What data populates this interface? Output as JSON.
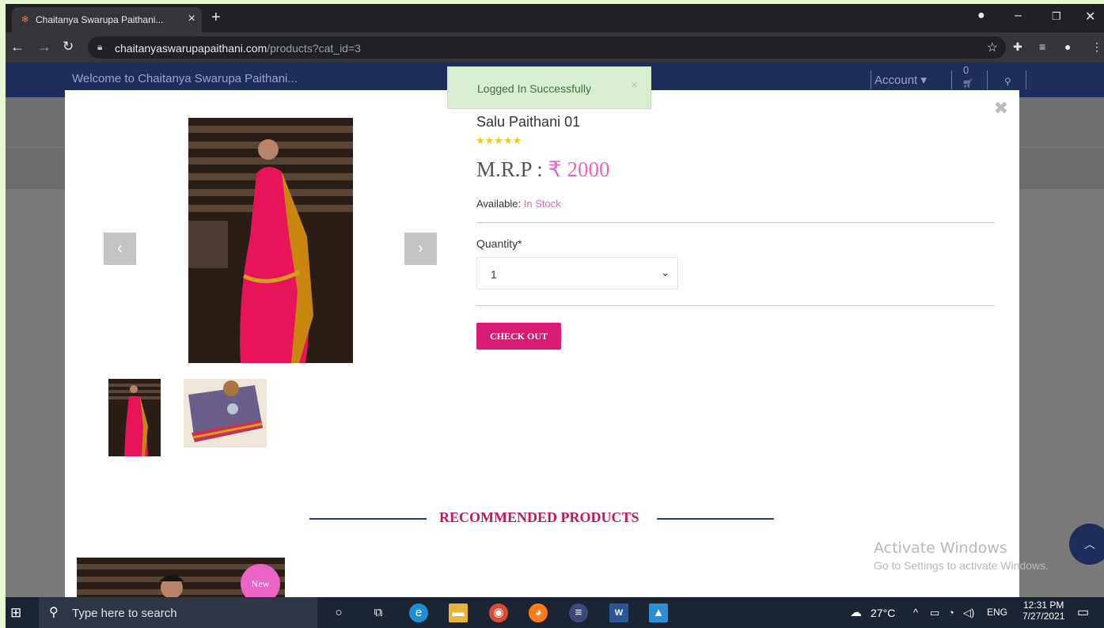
{
  "browser": {
    "tab_title": "Chaitanya Swarupa Paithani...",
    "url_host": "chaitanyaswarupapaithani.com",
    "url_path": "/products?cat_id=3"
  },
  "site": {
    "welcome": "Welcome to Chaitanya Swarupa Paithani...",
    "account_label": "Account",
    "cart_count": "0"
  },
  "toast": {
    "message": "Logged In Successfully"
  },
  "product": {
    "title": "Salu Paithani 01",
    "stars": "★★★★★",
    "rating": 5,
    "mrp_label": "M.R.P :",
    "price": "₹ 2000",
    "available_label": "Available:",
    "stock_status": "In Stock",
    "quantity_label": "Quantity*",
    "quantity_value": "1",
    "checkout_label": "CHECK OUT"
  },
  "recommended": {
    "heading": "RECOMMENDED PRODUCTS",
    "badge": "New"
  },
  "watermark": {
    "line1": "Activate Windows",
    "line2": "Go to Settings to activate Windows."
  },
  "taskbar": {
    "search_placeholder": "Type here to search",
    "weather": "27°C",
    "language": "ENG",
    "time": "12:31 PM",
    "date": "7/27/2021"
  },
  "colors": {
    "accent_pink": "#e964c4",
    "checkout_magenta": "#d81b73",
    "navy": "#1f2d5e",
    "toast_green": "#d9edd2"
  }
}
